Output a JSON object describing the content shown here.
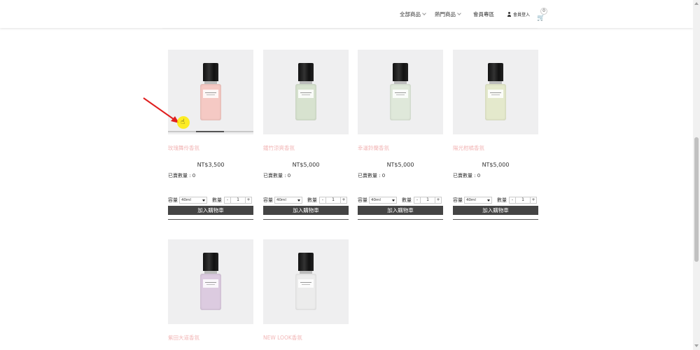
{
  "nav": {
    "all_products": "全部商品",
    "hot_products": "熱門商品",
    "member_area": "會員專區",
    "login": "會員登入",
    "cart_count": "0"
  },
  "labels": {
    "sold": "已賣數量 : 0",
    "capacity": "容量",
    "volume_option": "40ml",
    "quantity": "數量",
    "qty_value": "1",
    "minus": "-",
    "plus": "+",
    "add_to_cart": "加入購物車"
  },
  "products": [
    {
      "name": "玫瑰舞伶香氛",
      "price": "NT$3,500",
      "bottle_color": "#f5c9c4"
    },
    {
      "name": "鐵竹涼爽香氛",
      "price": "NT$5,000",
      "bottle_color": "#d7e2cf"
    },
    {
      "name": "幸運鈴蘭香氛",
      "price": "NT$5,000",
      "bottle_color": "#dfe8da"
    },
    {
      "name": "陽光柑橘香氛",
      "price": "NT$5,000",
      "bottle_color": "#e4e9cc"
    },
    {
      "name": "紫田大道香氛",
      "price": "",
      "bottle_color": "#dccbe0"
    },
    {
      "name": "NEW LOOK香氛",
      "price": "",
      "bottle_color": "#ececec"
    }
  ],
  "colors": {
    "product_name": "#f2b6b6",
    "button_bg": "#444444",
    "image_bg": "#efeff0",
    "annotation_arrow": "#e02020",
    "cursor_highlight": "#ffeb00"
  }
}
